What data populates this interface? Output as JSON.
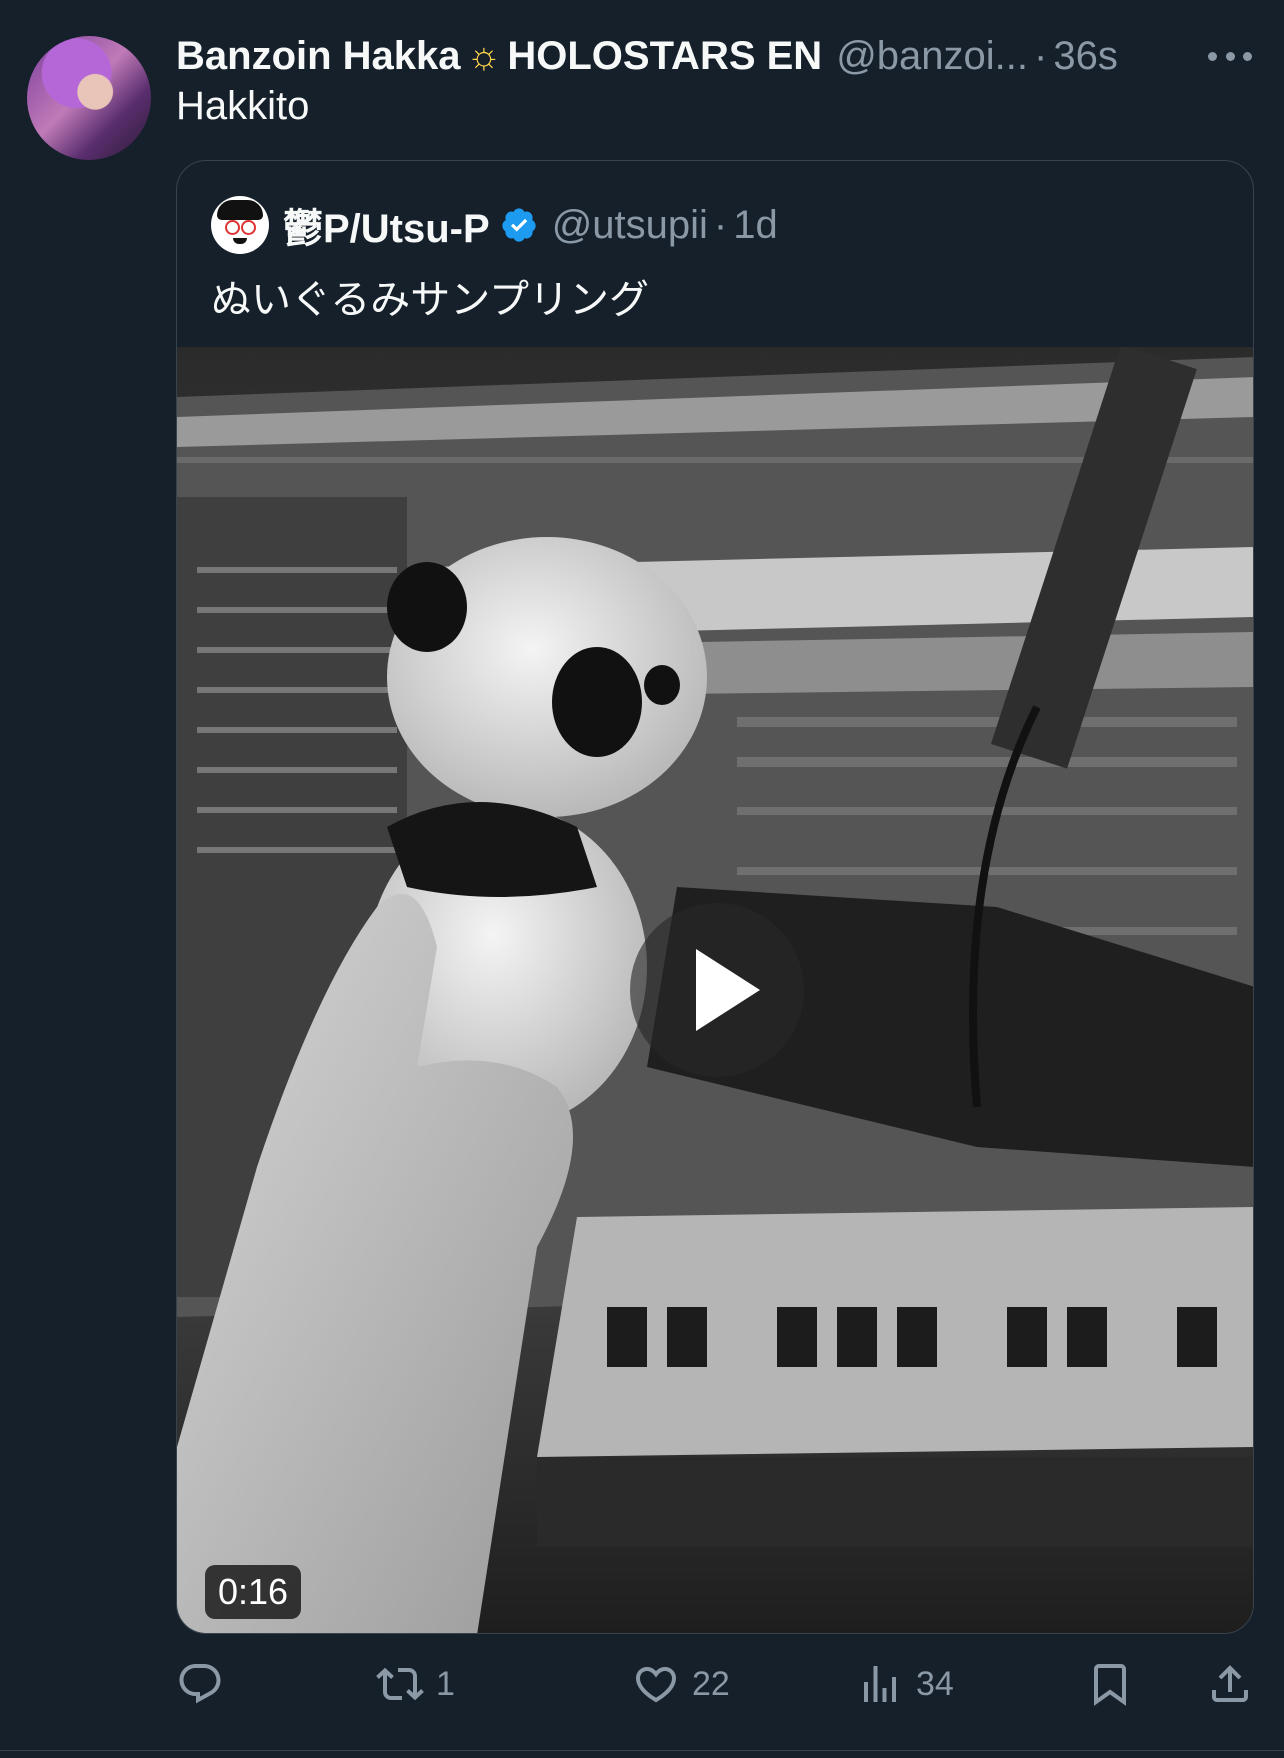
{
  "tweet": {
    "display_name": "Banzoin Hakka",
    "name_emoji": "☼",
    "org_name": "HOLOSTARS EN",
    "handle": "@banzoi...",
    "separator": "·",
    "time": "36s",
    "text": "Hakkito"
  },
  "quote": {
    "display_name": "鬱P/Utsu-P",
    "handle": "@utsupii",
    "separator": "·",
    "time": "1d",
    "text": "ぬいぐるみサンプリング",
    "video_duration": "0:16"
  },
  "actions": {
    "reply_icon": "reply-icon",
    "retweet_icon": "retweet-icon",
    "retweet_count": "1",
    "like_icon": "heart-icon",
    "like_count": "22",
    "views_icon": "views-icon",
    "views_count": "34",
    "bookmark_icon": "bookmark-icon",
    "share_icon": "share-icon"
  },
  "colors": {
    "background": "#15202b",
    "text": "#f7f9f9",
    "secondary": "#8b98a5",
    "border": "#38444d",
    "verified": "#1d9bf0"
  }
}
